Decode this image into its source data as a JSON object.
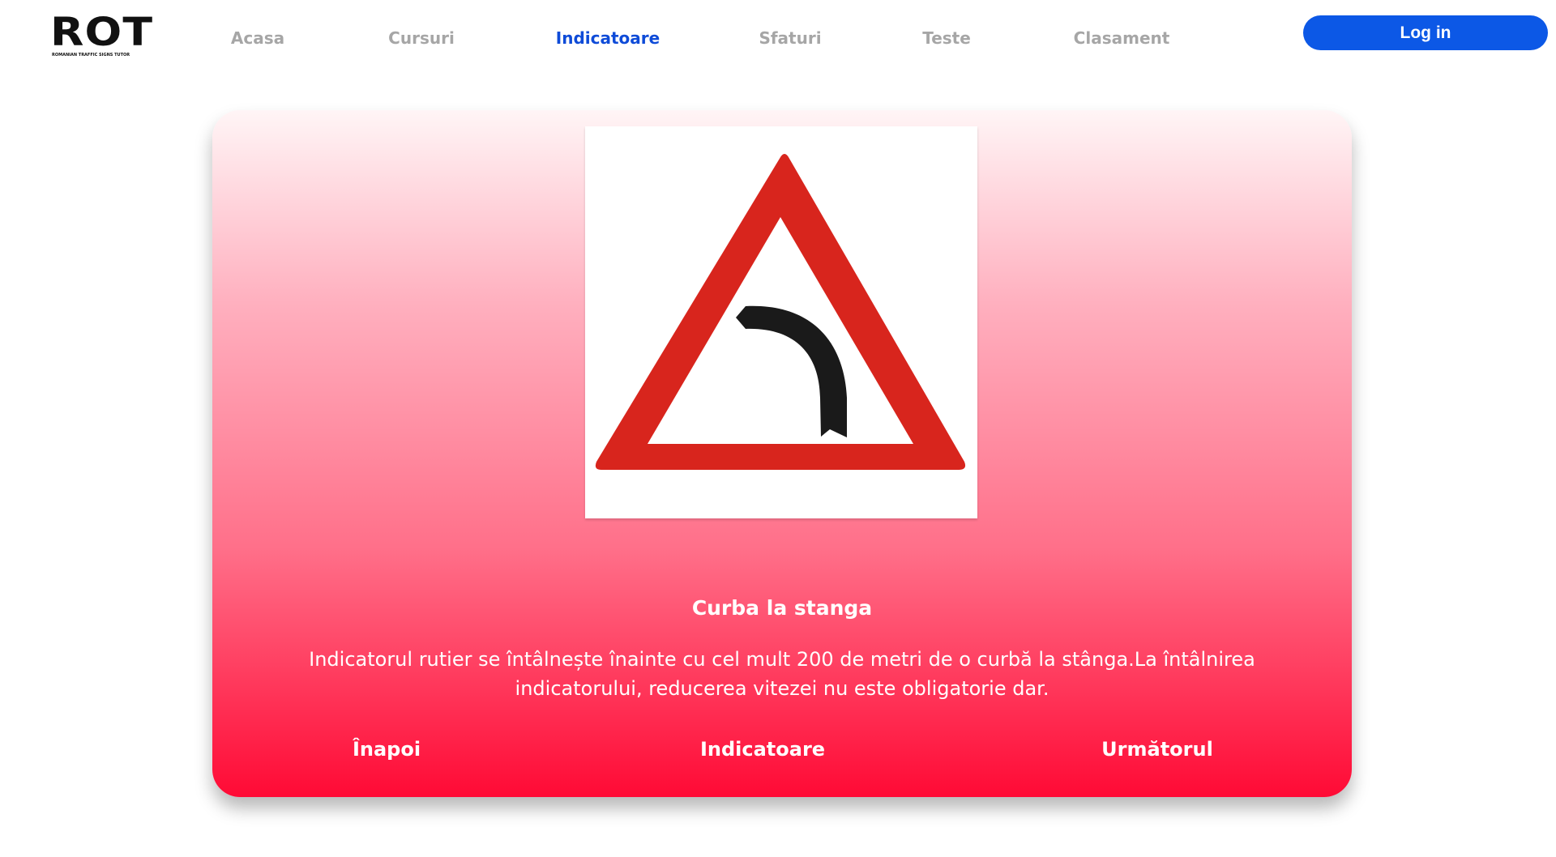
{
  "logo": {
    "main": "ROT",
    "sub": "ROMANIAN TRAFFIC SIGNS TUTOR"
  },
  "nav": {
    "items": [
      {
        "label": "Acasa",
        "active": false
      },
      {
        "label": "Cursuri",
        "active": false
      },
      {
        "label": "Indicatoare",
        "active": true
      },
      {
        "label": "Sfaturi",
        "active": false
      },
      {
        "label": "Teste",
        "active": false
      },
      {
        "label": "Clasament",
        "active": false
      }
    ],
    "login_label": "Log in"
  },
  "sign": {
    "icon": "left-curve-warning-sign-icon",
    "title": "Curba la stanga",
    "description": "Indicatorul rutier se întâlnește înainte cu cel mult 200 de metri de o curbă la stânga.La întâlnirea indicatorului, reducerea vitezei nu este obligatorie dar."
  },
  "card_nav": {
    "prev_label": "Înapoi",
    "list_label": "Indicatoare",
    "next_label": "Următorul"
  },
  "colors": {
    "accent": "#0c58e6",
    "active_nav": "#0e4bd8",
    "inactive_nav": "#a6a6a6",
    "card_top": "#fff5f6",
    "card_bottom": "#ff0a35",
    "sign_red": "#d8251d",
    "sign_black": "#1a1a1a"
  }
}
